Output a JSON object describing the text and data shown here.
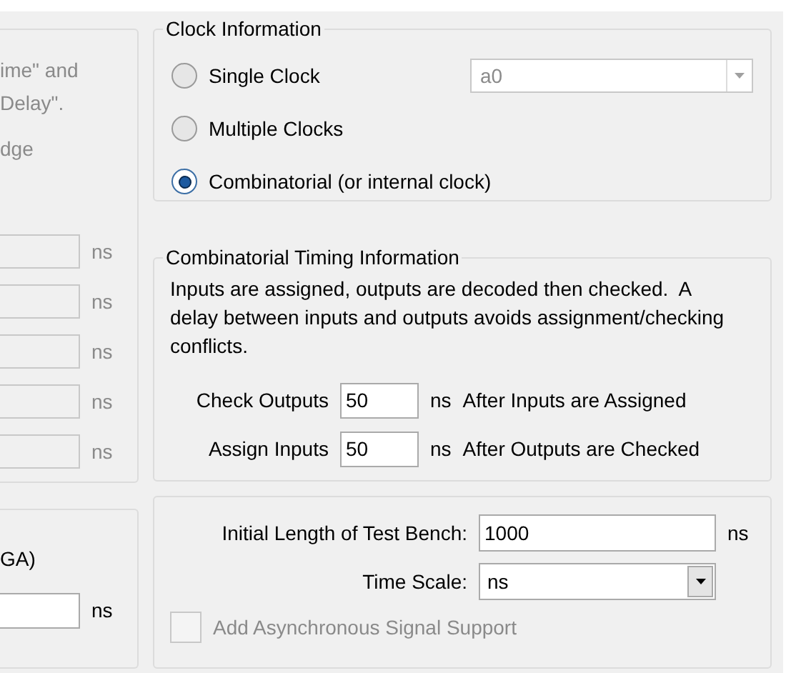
{
  "left_panel": {
    "text_lines": [
      "ime\" and",
      "Delay\".",
      "dge"
    ],
    "fields": [
      {
        "unit": "ns",
        "disabled": true
      },
      {
        "unit": "ns",
        "disabled": true
      },
      {
        "unit": "ns",
        "disabled": true
      },
      {
        "unit": "ns",
        "disabled": true
      },
      {
        "unit": "ns",
        "disabled": true
      }
    ]
  },
  "left_bottom_panel": {
    "label": "GA)",
    "field": {
      "unit": "ns",
      "disabled": false
    }
  },
  "clock_information": {
    "title": "Clock Information",
    "options": [
      {
        "label": "Single Clock",
        "selected": false
      },
      {
        "label": "Multiple Clocks",
        "selected": false
      },
      {
        "label": "Combinatorial (or internal clock)",
        "selected": true
      }
    ],
    "clock_select": {
      "value": "a0",
      "disabled": true
    }
  },
  "combinatorial_timing": {
    "title": "Combinatorial Timing Information",
    "description": "Inputs are assigned, outputs are decoded then checked.  A delay between inputs and outputs avoids assignment/checking conflicts.",
    "rows": [
      {
        "label": "Check Outputs",
        "value": "50",
        "unit": "ns",
        "note": "After Inputs are Assigned"
      },
      {
        "label": "Assign Inputs",
        "value": "50",
        "unit": "ns",
        "note": "After Outputs are Checked"
      }
    ]
  },
  "test_bench": {
    "length_label": "Initial Length of Test Bench:",
    "length_value": "1000",
    "length_unit": "ns",
    "time_scale_label": "Time Scale:",
    "time_scale_value": "ns",
    "async_checkbox": {
      "label": "Add Asynchronous Signal Support",
      "checked": false,
      "disabled": true
    }
  }
}
